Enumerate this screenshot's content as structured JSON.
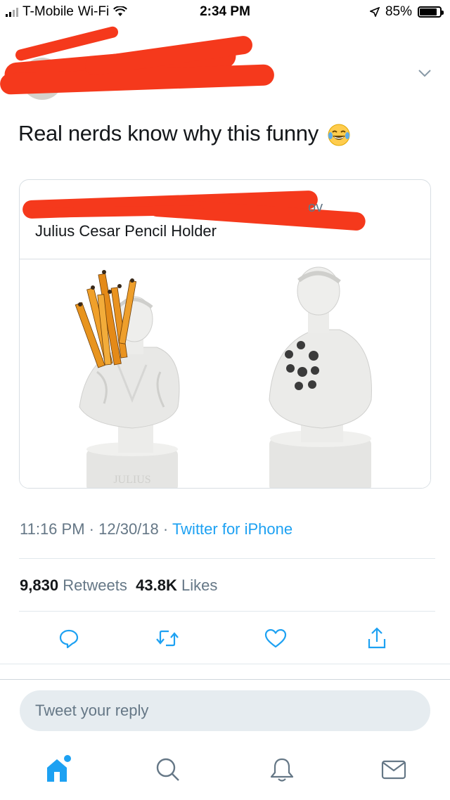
{
  "status_bar": {
    "carrier": "T-Mobile",
    "network": "Wi-Fi",
    "time": "2:34 PM",
    "battery": "85%",
    "battery_level": 0.85
  },
  "tweet": {
    "text": "Real nerds know why this funny",
    "emoji": "face-with-tears-of-joy"
  },
  "quoted": {
    "handle_fragment": "ov",
    "title": "Julius Cesar Pencil Holder",
    "bust_label": "JULIUS"
  },
  "info": {
    "time": "11:16 PM",
    "date": "12/30/18",
    "separator": "·",
    "source": "Twitter for iPhone"
  },
  "stats": {
    "retweets": "9,830",
    "retweets_label": "Retweets",
    "likes": "43.8K",
    "likes_label": "Likes"
  },
  "reply": {
    "placeholder": "Tweet your reply"
  },
  "colors": {
    "accent": "#1da1f2",
    "muted": "#657786",
    "redaction": "#f5391c"
  },
  "icons": {
    "actions": [
      "reply-icon",
      "retweet-icon",
      "like-icon",
      "share-icon"
    ],
    "tabs": [
      "home-icon",
      "search-icon",
      "notifications-icon",
      "messages-icon"
    ]
  }
}
